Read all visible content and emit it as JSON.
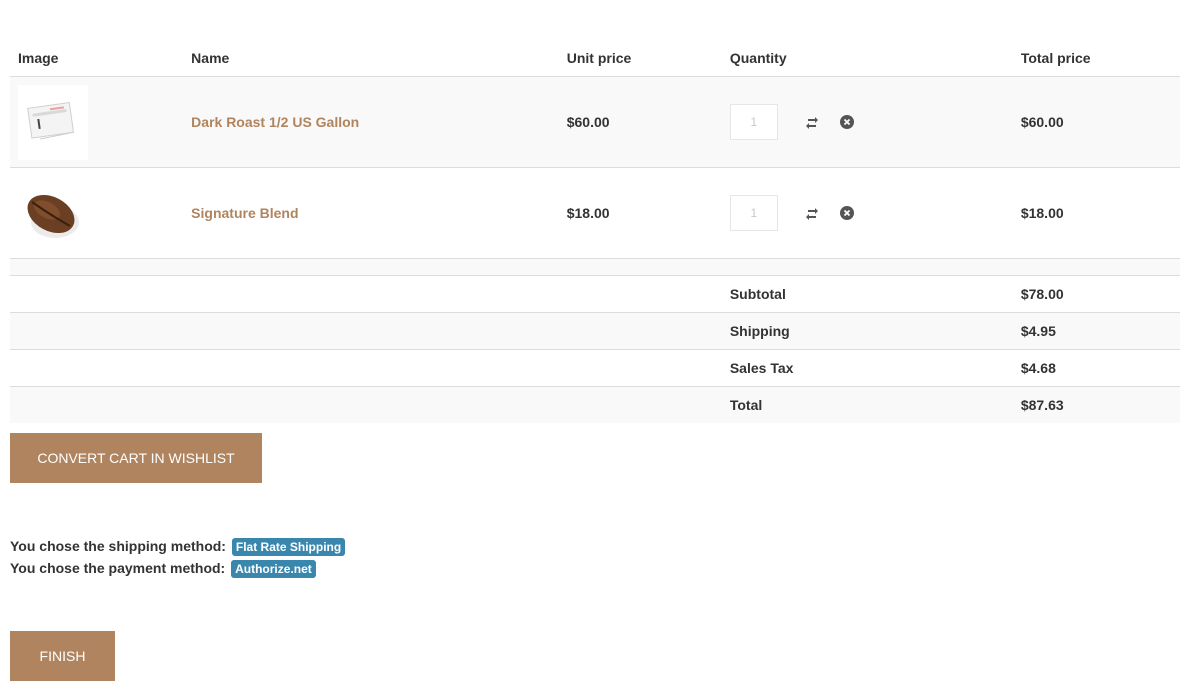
{
  "table": {
    "headers": [
      "Image",
      "Name",
      "Unit price",
      "Quantity",
      "Total price"
    ],
    "items": [
      {
        "name": "Dark Roast 1/2 US Gallon",
        "unit_price": "$60.00",
        "quantity": "1",
        "total": "$60.00",
        "image_icon": "product-card-image"
      },
      {
        "name": "Signature Blend",
        "unit_price": "$18.00",
        "quantity": "1",
        "total": "$18.00",
        "image_icon": "coffee-bean-image"
      }
    ]
  },
  "summary": {
    "rows": [
      {
        "label": "Subtotal",
        "value": "$78.00"
      },
      {
        "label": "Shipping",
        "value": "$4.95"
      },
      {
        "label": "Sales Tax",
        "value": "$4.68"
      },
      {
        "label": "Total",
        "value": "$87.63"
      }
    ]
  },
  "buttons": {
    "convert": "CONVERT CART IN WISHLIST",
    "finish": "FINISH"
  },
  "methods": {
    "shipping_label": "You chose the shipping method:",
    "shipping_value": "Flat Rate Shipping",
    "payment_label": "You chose the payment method:",
    "payment_value": "Authorize.net"
  },
  "colors": {
    "accent": "#b0845e",
    "badge": "#3a87ad"
  },
  "icons": {
    "update": "refresh-icon",
    "remove": "close-circle-icon"
  }
}
